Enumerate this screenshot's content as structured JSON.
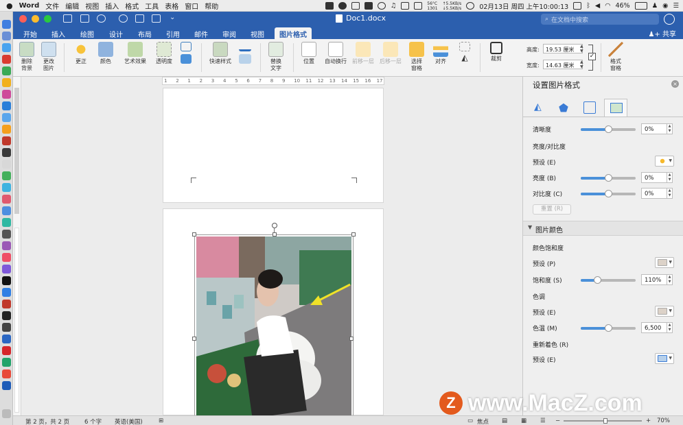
{
  "menubar": {
    "app_name": "Word",
    "items": [
      "文件",
      "编辑",
      "视图",
      "插入",
      "格式",
      "工具",
      "表格",
      "窗口",
      "帮助"
    ],
    "temp": "56°C",
    "temp_rpm": "1301",
    "net_up": "↑5.5KB/s",
    "net_down": "↓5.5KB/s",
    "clock": "02月13日 周四 上午10:00:13",
    "battery": "46%"
  },
  "window": {
    "title": "Doc1.docx",
    "search_placeholder": "在文档中搜索"
  },
  "tabs": [
    "开始",
    "插入",
    "绘图",
    "设计",
    "布局",
    "引用",
    "邮件",
    "审阅",
    "视图",
    "图片格式"
  ],
  "active_tab": "图片格式",
  "share_label": "共享",
  "ribbon": {
    "remove_bg": "删除\n背景",
    "change_pic": "更改\n图片",
    "corrections": "更正",
    "color": "颜色",
    "artistic": "艺术效果",
    "transparency": "透明度",
    "quick_styles": "快速样式",
    "alt_text": "替换\n文字",
    "position": "位置",
    "wrap_text": "自动换行",
    "bring_forward": "前移一层",
    "send_backward": "后移一层",
    "selection_pane": "选择\n窗格",
    "align": "对齐",
    "crop": "裁剪",
    "height_label": "高度:",
    "height_value": "19.53 厘米",
    "width_label": "宽度:",
    "width_value": "14.63 厘米",
    "format_pane": "格式\n窗格"
  },
  "ruler_marks": [
    "1",
    "2",
    "1",
    "2",
    "3",
    "4",
    "5",
    "6",
    "7",
    "8",
    "9",
    "10",
    "11",
    "12",
    "13",
    "14",
    "15",
    "16",
    "17"
  ],
  "panel": {
    "title": "设置图片格式",
    "sharpness_label": "清晰度",
    "sharpness_value": "0%",
    "sharpness_level": 0.5,
    "brightness_contrast_heading": "亮度/对比度",
    "preset_label": "预设 (E)",
    "brightness_label": "亮度 (B)",
    "brightness_value": "0%",
    "brightness_level": 0.5,
    "contrast_label": "对比度 (C)",
    "contrast_value": "0%",
    "contrast_level": 0.5,
    "reset_label": "重置 (R)",
    "picture_color_heading": "图片颜色",
    "saturation_heading": "颜色饱和度",
    "saturation_preset_label": "预设 (P)",
    "saturation_label": "饱和度 (S)",
    "saturation_value": "110%",
    "saturation_level": 0.3,
    "tone_heading": "色调",
    "tone_preset_label": "预设 (E)",
    "temperature_label": "色温 (M)",
    "temperature_value": "6,500",
    "temperature_level": 0.5,
    "recolor_heading": "重新着色 (R)",
    "recolor_preset_label": "预设 (E)"
  },
  "status": {
    "page": "第 2 页，共 2 页",
    "words": "6 个字",
    "language": "英语(美国)",
    "focus": "焦点",
    "zoom": "70%",
    "zoom_level": 0.55
  },
  "watermark": "www.MacZ.com",
  "watermark_logo": "Z",
  "colors": {
    "office_blue": "#2c5fae",
    "slider_blue": "#4a90d9",
    "watermark_orange": "#e35a1d"
  }
}
